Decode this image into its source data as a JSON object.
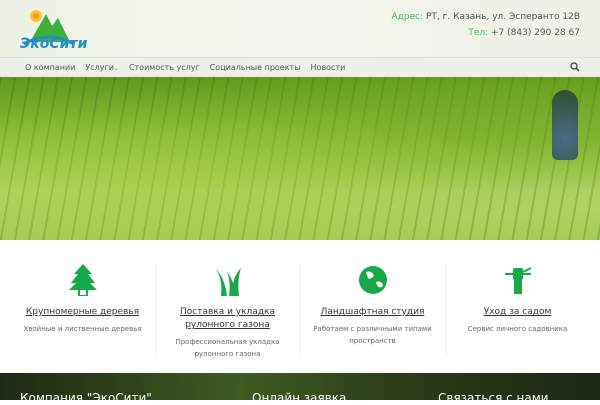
{
  "header": {
    "logo_text": "ЭкоСити",
    "address_label": "Адрес:",
    "address": "РТ, г. Казань, ул. Эсперанто 12В",
    "phone_label": "Тел:",
    "phone": "+7 (843) 290 28 67"
  },
  "nav": {
    "items": [
      "О компании",
      "Услуги",
      "Стоимость услуг",
      "Социальные проекты",
      "Новости"
    ]
  },
  "features": [
    {
      "icon": "tree-icon",
      "title": "Крупномерные деревья",
      "desc": "Хвойные и лиственные деревья"
    },
    {
      "icon": "grass-icon",
      "title": "Поставка и укладка рулонного газона",
      "desc": "Профессиональная укладка рулонного газона"
    },
    {
      "icon": "globe-icon",
      "title": "Ландшафтная студия",
      "desc": "Работаем с различными типами пространств"
    },
    {
      "icon": "hand-plant-icon",
      "title": "Уход за садом",
      "desc": "Сервис личного садовника"
    }
  ],
  "footer": {
    "headings": [
      "Компания \"ЭкоСити\"",
      "Онлайн заявка",
      "Связаться с нами"
    ]
  },
  "colors": {
    "accent": "#17a84a"
  }
}
